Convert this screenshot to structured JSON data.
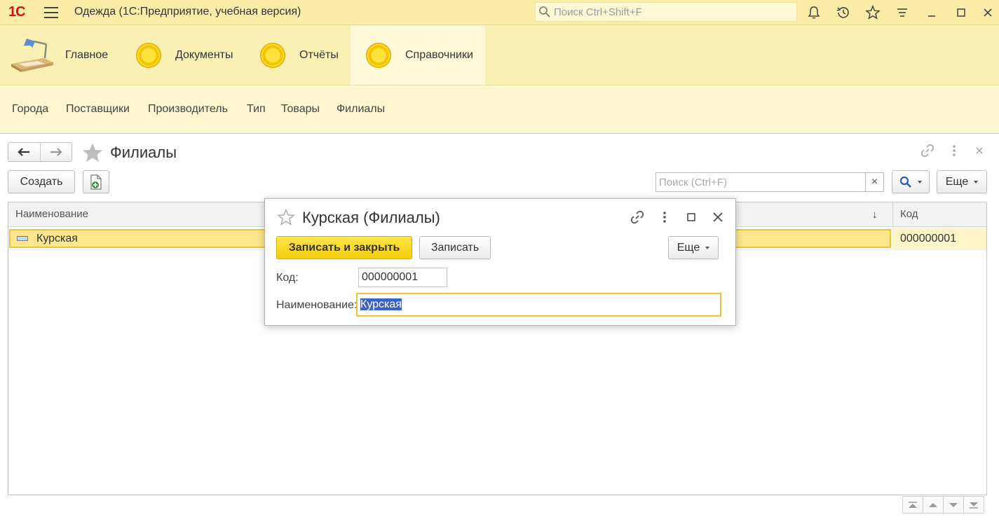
{
  "window": {
    "logo": "1С",
    "title": "Одежда  (1С:Предприятие, учебная версия)",
    "search_placeholder": "Поиск Ctrl+Shift+F"
  },
  "sections": [
    {
      "label": "Главное",
      "icon": "desk-lamp-icon"
    },
    {
      "label": "Документы",
      "icon": "coin-icon"
    },
    {
      "label": "Отчёты",
      "icon": "coin-icon"
    },
    {
      "label": "Справочники",
      "icon": "coin-icon",
      "active": true
    }
  ],
  "nav_panel": {
    "items": [
      "Города",
      "Поставщики",
      "Производитель",
      "Тип",
      "Товары",
      "Филиалы"
    ]
  },
  "list_form": {
    "title": "Филиалы",
    "create_label": "Создать",
    "search_placeholder": "Поиск (Ctrl+F)",
    "clear_label": "×",
    "more_label": "Еще",
    "columns": {
      "name": "Наименование",
      "sort_indicator": "↓",
      "code": "Код"
    },
    "rows": [
      {
        "name": "Курская",
        "code": "000000001"
      }
    ]
  },
  "item_form": {
    "title": "Курская (Филиалы)",
    "save_close_label": "Записать и закрыть",
    "save_label": "Записать",
    "more_label": "Еще",
    "code_label": "Код:",
    "code_value": "000000001",
    "name_label": "Наименование:",
    "name_value": "Курская"
  },
  "colors": {
    "titlebar": "#fbeda8",
    "section_panel": "#fbf0b4",
    "nav_panel": "#fdf6cf",
    "primary_button": "#f5cc0a",
    "selected_row": "#fde68e",
    "focus_border": "#f1c230",
    "text_selection": "#3d63c2"
  }
}
